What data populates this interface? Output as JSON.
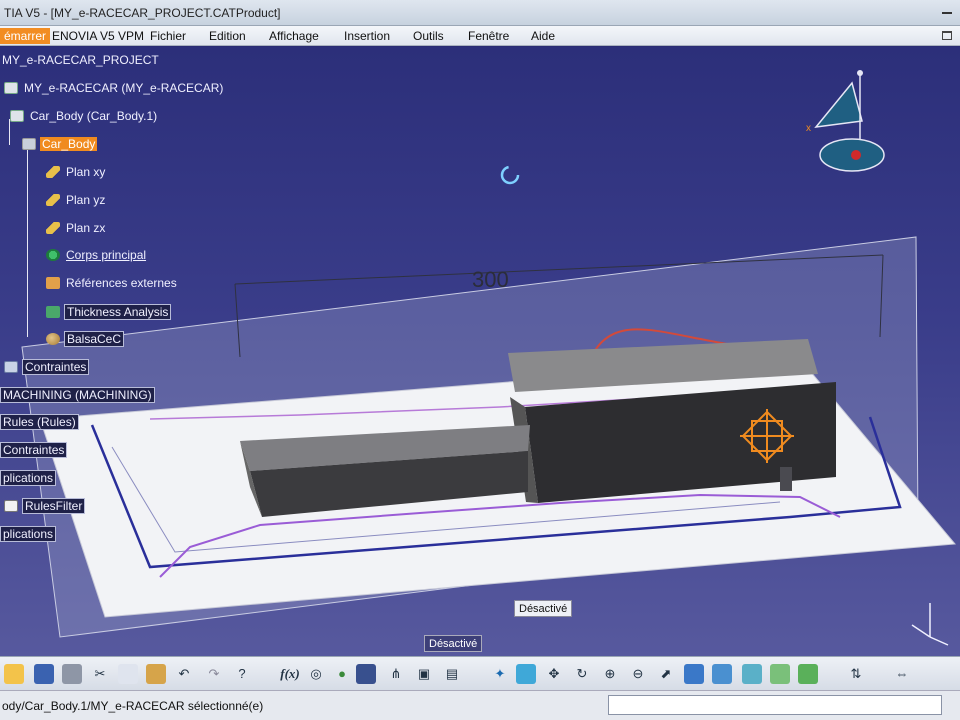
{
  "window": {
    "title": "TIA V5 - [MY_e-RACECAR_PROJECT.CATProduct]"
  },
  "menu": {
    "items": [
      "émarrer",
      "ENOVIA V5 VPM",
      "Fichier",
      "Edition",
      "Affichage",
      "Insertion",
      "Outils",
      "Fenêtre",
      "Aide"
    ],
    "active_index": 0
  },
  "tree": {
    "root": "MY_e-RACECAR_PROJECT",
    "product": "MY_e-RACECAR (MY_e-RACECAR)",
    "car_body": "Car_Body (Car_Body.1)",
    "selected_part": "Car_Body",
    "plane_xy": "Plan xy",
    "plane_yz": "Plan yz",
    "plane_zx": "Plan zx",
    "main_body": "Corps principal",
    "external_refs": "Références externes",
    "thickness": "Thickness Analysis",
    "balsa": "BalsaCeC",
    "constraints_1": "Contraintes",
    "machining": "MACHINING (MACHINING)",
    "rules": "Rules (Rules)",
    "constraints_2": "Contraintes",
    "applications_1": "plications",
    "rules_filter": "RulesFilter",
    "applications_2": "plications"
  },
  "viewport": {
    "dimension": "300",
    "tag_desactive_1": "Désactivé",
    "tag_desactive_2": "Désactivé"
  },
  "colors": {
    "selection": "#f08b1f",
    "background_top": "#2c2f7a",
    "background_bottom": "#57599e"
  },
  "toolbar": {
    "fx_label": "f(x)",
    "icons": [
      "open-icon",
      "save-icon",
      "print-icon",
      "cut-icon",
      "copy-icon",
      "paste-icon",
      "undo-icon",
      "redo-icon",
      "help-icon",
      "formula-icon",
      "comment-icon",
      "knowledge-icon",
      "table-icon",
      "tree-icon",
      "lock-icon",
      "toggle-icon",
      "fly-icon",
      "fit-all-icon",
      "pan-icon",
      "rotate-icon",
      "zoom-in-icon",
      "zoom-out-icon",
      "normal-view-icon",
      "multi-view-icon",
      "iso-view-icon",
      "shading-icon",
      "hide-show-icon",
      "swap-visible-icon",
      "catalog-icon",
      "measure-icon"
    ]
  },
  "status": {
    "message": "ody/Car_Body.1/MY_e-RACECAR sélectionné(e)",
    "command_value": ""
  }
}
